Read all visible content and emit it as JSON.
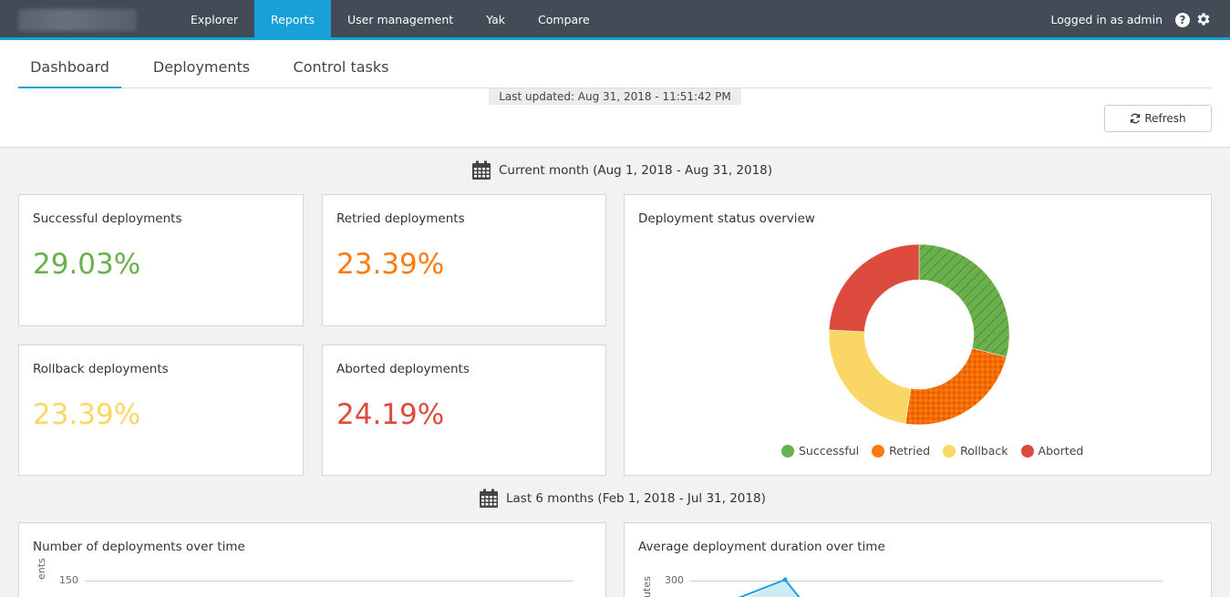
{
  "nav": {
    "items": [
      "Explorer",
      "Reports",
      "User management",
      "Yak",
      "Compare"
    ],
    "active": "Reports",
    "user_text": "Logged in as admin",
    "help_glyph": "?"
  },
  "tabs": [
    "Dashboard",
    "Deployments",
    "Control tasks"
  ],
  "last_updated": "Last updated: Aug 31, 2018 - 11:51:42 PM",
  "refresh_label": "Refresh",
  "current_section": "Current month (Aug 1, 2018 - Aug 31, 2018)",
  "kpis": {
    "successful": {
      "title": "Successful deployments",
      "value": "29.03%"
    },
    "retried": {
      "title": "Retried deployments",
      "value": "23.39%"
    },
    "rollback": {
      "title": "Rollback deployments",
      "value": "23.39%"
    },
    "aborted": {
      "title": "Aborted deployments",
      "value": "24.19%"
    }
  },
  "colors": {
    "successful": "#6ab04c",
    "retried": "#ff7a0d",
    "rollback": "#fad764",
    "aborted": "#dd4b3e",
    "accent": "#1aa0d9"
  },
  "overview": {
    "title": "Deployment status overview",
    "legend": [
      "Successful",
      "Retried",
      "Rollback",
      "Aborted"
    ]
  },
  "chart_data": {
    "type": "pie",
    "categories": [
      "Successful",
      "Retried",
      "Rollback",
      "Aborted"
    ],
    "values": [
      29.03,
      23.39,
      23.39,
      24.19
    ]
  },
  "last6_section": "Last 6 months (Feb 1, 2018 - Jul 31, 2018)",
  "count_chart": {
    "title": "Number of deployments over time",
    "tick_top": "150",
    "ylabel_fragment": "ents"
  },
  "duration_chart": {
    "title": "Average deployment duration over time",
    "tick_top": "300",
    "ylabel_fragment": "utes"
  }
}
